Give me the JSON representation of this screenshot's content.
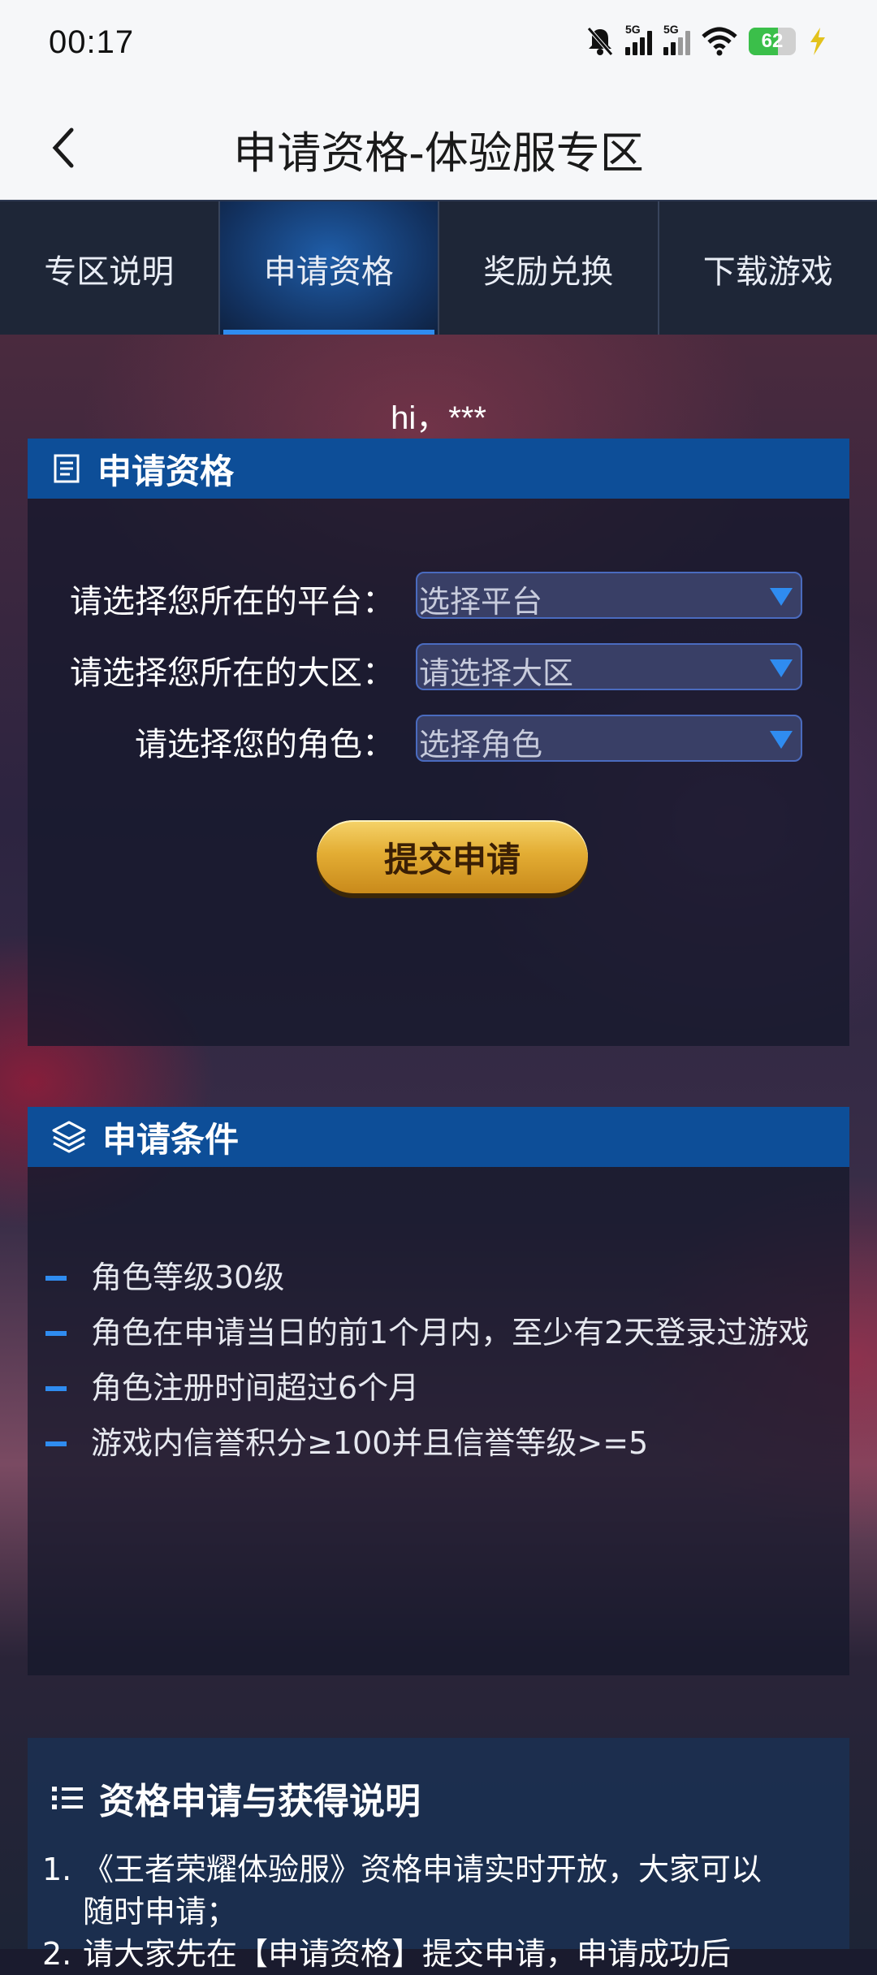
{
  "status": {
    "time": "00:17",
    "net1": "5G",
    "net2": "5G",
    "battery": "62"
  },
  "header": {
    "title": "申请资格-体验服专区"
  },
  "tabs": [
    {
      "label": "专区说明"
    },
    {
      "label": "申请资格"
    },
    {
      "label": "奖励兑换"
    },
    {
      "label": "下载游戏"
    }
  ],
  "greeting": "hi，***",
  "apply": {
    "title": "申请资格",
    "rows": [
      {
        "label": "请选择您所在的平台：",
        "value": "选择平台"
      },
      {
        "label": "请选择您所在的大区：",
        "value": "请选择大区"
      },
      {
        "label": "请选择您的角色：",
        "value": "选择角色"
      }
    ],
    "submit": "提交申请"
  },
  "conditions": {
    "title": "申请条件",
    "items": [
      "角色等级30级",
      "角色在申请当日的前1个月内，至少有2天登录过游戏",
      "角色注册时间超过6个月",
      "游戏内信誉积分≥100并且信誉等级>=5"
    ]
  },
  "info": {
    "title": "资格申请与获得说明",
    "line1_num": "1.",
    "line1": "《王者荣耀体验服》资格申请实时开放，大家可以",
    "line1b": "随时申请；",
    "line2_num": "2.",
    "line2": "请大家先在【申请资格】提交申请，申请成功后"
  }
}
